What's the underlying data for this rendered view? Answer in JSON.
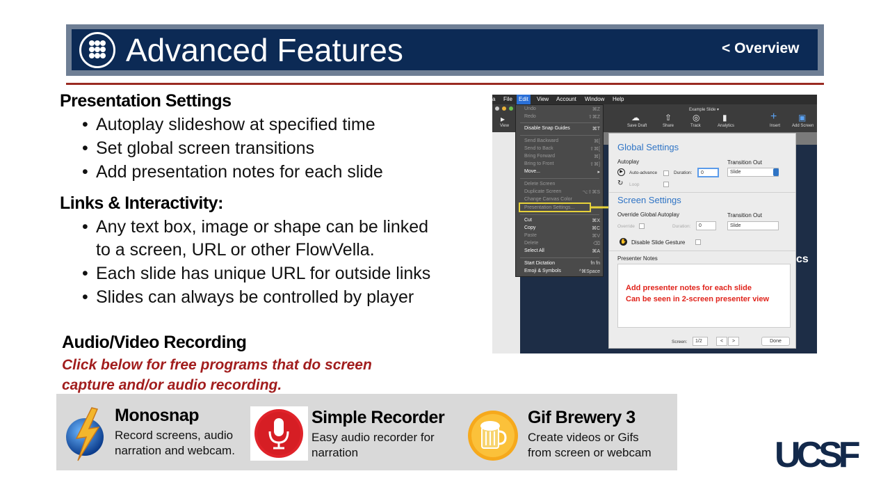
{
  "header": {
    "title": "Advanced Features",
    "overview_link": "< Overview",
    "colors": {
      "bar": "#0c2a55",
      "frame": "#6f7f95",
      "rule": "#9a2a22"
    }
  },
  "sections": {
    "presentation": {
      "heading": "Presentation Settings",
      "bullets": [
        "Autoplay slideshow at specified time",
        "Set global screen transitions",
        "Add presentation notes for each slide"
      ]
    },
    "links": {
      "heading": "Links & Interactivity:",
      "bullets": [
        "Any text box, image or shape can be linked",
        "to a screen, URL or other FlowVella.",
        "Each slide has unique URL for outside links",
        "Slides can always be controlled by player"
      ]
    },
    "av": {
      "heading": "Audio/Video Recording",
      "note_line1": "Click below for free programs that do screen",
      "note_line2": "capture and/or audio recording."
    }
  },
  "screenshot": {
    "menubar": [
      "File",
      "Edit",
      "View",
      "Account",
      "Window",
      "Help"
    ],
    "slide_title": "Example Slide ▾",
    "toolbar": [
      "View",
      "Save Draft",
      "Share",
      "Track",
      "Analytics",
      "Insert",
      "Add Screen"
    ],
    "edit_menu": [
      {
        "label": "Undo",
        "shortcut": "⌘Z",
        "dim": true
      },
      {
        "label": "Redo",
        "shortcut": "⇧⌘Z",
        "dim": true
      },
      {
        "label": "Disable Snap Guides",
        "shortcut": "⌘T",
        "dim": false
      },
      {
        "label": "Send Backward",
        "shortcut": "⌘[",
        "dim": true
      },
      {
        "label": "Send to Back",
        "shortcut": "⇧⌘[",
        "dim": true
      },
      {
        "label": "Bring Forward",
        "shortcut": "⌘]",
        "dim": true
      },
      {
        "label": "Bring to Front",
        "shortcut": "⇧⌘]",
        "dim": true
      },
      {
        "label": "Move...",
        "shortcut": "▸",
        "dim": false
      },
      {
        "label": "Delete Screen",
        "shortcut": "",
        "dim": true
      },
      {
        "label": "Duplicate Screen",
        "shortcut": "⌥⇧⌘S",
        "dim": true
      },
      {
        "label": "Change Canvas Color",
        "shortcut": "",
        "dim": true
      },
      {
        "label": "Presentation Settings...",
        "shortcut": "",
        "dim": true
      },
      {
        "label": "Cut",
        "shortcut": "⌘X",
        "dim": false
      },
      {
        "label": "Copy",
        "shortcut": "⌘C",
        "dim": false
      },
      {
        "label": "Paste",
        "shortcut": "⌘V",
        "dim": true
      },
      {
        "label": "Delete",
        "shortcut": "⌫",
        "dim": true
      },
      {
        "label": "Select All",
        "shortcut": "⌘A",
        "dim": false
      },
      {
        "label": "Start Dictation",
        "shortcut": "fn fn",
        "dim": false
      },
      {
        "label": "Emoji & Symbols",
        "shortcut": "^⌘Space",
        "dim": false
      }
    ],
    "sheet": {
      "global_title": "Global Settings",
      "autoplay": "Autoplay",
      "transition_out": "Transition Out",
      "auto_advance": "Auto-advance",
      "duration": "Duration:",
      "duration_value": "0",
      "slide_option": "Slide",
      "loop": "Loop",
      "screen_title": "Screen Settings",
      "override_autoplay": "Override Global Autoplay",
      "transition_out2": "Transition Out",
      "override": "Override",
      "duration2": "Duration:",
      "duration2_value": "0",
      "slide_option2": "Slide",
      "disable_gesture": "Disable Slide Gesture",
      "presenter_notes": "Presenter Notes",
      "notes_line1": "Add presenter notes for each slide",
      "notes_line2": "Can be seen in 2-screen presenter view",
      "screen_label": "Screen:",
      "screen_value": "1/2",
      "prev": "<",
      "next": ">",
      "done": "Done"
    },
    "background_text": "cs"
  },
  "apps": [
    {
      "name": "Monosnap",
      "desc1": "Record screens, audio",
      "desc2": "narration and webcam.",
      "icon": "monosnap-lightning-icon"
    },
    {
      "name": "Simple Recorder",
      "desc1": "Easy audio recorder for",
      "desc2": "narration",
      "icon": "microphone-icon"
    },
    {
      "name": "Gif Brewery 3",
      "desc1": "Create videos or Gifs",
      "desc2": "from screen or webcam",
      "icon": "beer-mug-icon"
    }
  ],
  "logo": "UCSF"
}
